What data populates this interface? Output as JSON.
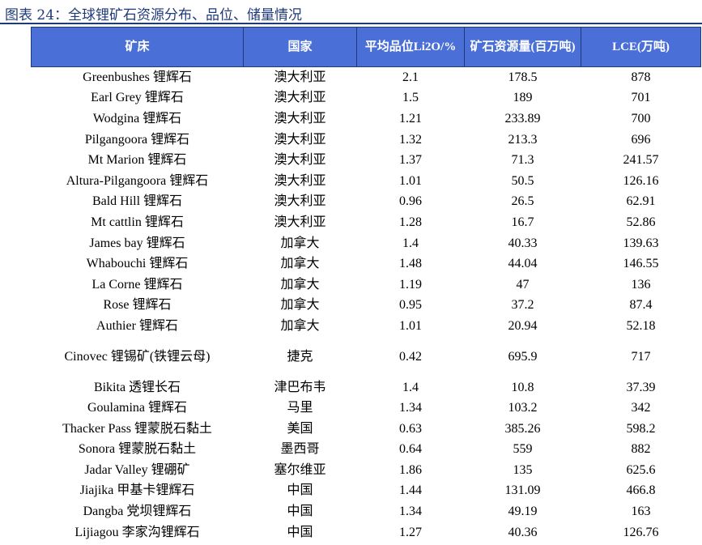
{
  "title": "图表 24：全球锂矿石资源分布、品位、储量情况",
  "headers": [
    "矿床",
    "国家",
    "平均品位Li2O/%",
    "矿石资源量(百万吨)",
    "LCE(万吨)"
  ],
  "rows": [
    {
      "name": "Greenbushes 锂辉石",
      "country": "澳大利亚",
      "grade": "2.1",
      "ore": "178.5",
      "lce": "878"
    },
    {
      "name": "Earl Grey 锂辉石",
      "country": "澳大利亚",
      "grade": "1.5",
      "ore": "189",
      "lce": "701"
    },
    {
      "name": "Wodgina 锂辉石",
      "country": "澳大利亚",
      "grade": "1.21",
      "ore": "233.89",
      "lce": "700"
    },
    {
      "name": "Pilgangoora 锂辉石",
      "country": "澳大利亚",
      "grade": "1.32",
      "ore": "213.3",
      "lce": "696"
    },
    {
      "name": "Mt Marion 锂辉石",
      "country": "澳大利亚",
      "grade": "1.37",
      "ore": "71.3",
      "lce": "241.57"
    },
    {
      "name": "Altura-Pilgangoora 锂辉石",
      "country": "澳大利亚",
      "grade": "1.01",
      "ore": "50.5",
      "lce": "126.16"
    },
    {
      "name": "Bald Hill 锂辉石",
      "country": "澳大利亚",
      "grade": "0.96",
      "ore": "26.5",
      "lce": "62.91"
    },
    {
      "name": "Mt cattlin 锂辉石",
      "country": "澳大利亚",
      "grade": "1.28",
      "ore": "16.7",
      "lce": "52.86"
    },
    {
      "name": "James bay 锂辉石",
      "country": "加拿大",
      "grade": "1.4",
      "ore": "40.33",
      "lce": "139.63"
    },
    {
      "name": "Whabouchi 锂辉石",
      "country": "加拿大",
      "grade": "1.48",
      "ore": "44.04",
      "lce": "146.55"
    },
    {
      "name": "La Corne 锂辉石",
      "country": "加拿大",
      "grade": "1.19",
      "ore": "47",
      "lce": "136"
    },
    {
      "name": "Rose 锂辉石",
      "country": "加拿大",
      "grade": "0.95",
      "ore": "37.2",
      "lce": "87.4"
    },
    {
      "name": "Authier 锂辉石",
      "country": "加拿大",
      "grade": "1.01",
      "ore": "20.94",
      "lce": "52.18"
    },
    {
      "name": "Cinovec 锂锡矿(铁锂云母)",
      "country": "捷克",
      "grade": "0.42",
      "ore": "695.9",
      "lce": "717"
    },
    {
      "name": "Bikita 透锂长石",
      "country": "津巴布韦",
      "grade": "1.4",
      "ore": "10.8",
      "lce": "37.39"
    },
    {
      "name": "Goulamina 锂辉石",
      "country": "马里",
      "grade": "1.34",
      "ore": "103.2",
      "lce": "342"
    },
    {
      "name": "Thacker Pass 锂蒙脱石黏土",
      "country": "美国",
      "grade": "0.63",
      "ore": "385.26",
      "lce": "598.2"
    },
    {
      "name": "Sonora 锂蒙脱石黏土",
      "country": "墨西哥",
      "grade": "0.64",
      "ore": "559",
      "lce": "882"
    },
    {
      "name": "Jadar Valley 锂硼矿",
      "country": "塞尔维亚",
      "grade": "1.86",
      "ore": "135",
      "lce": "625.6"
    },
    {
      "name": "Jiajika 甲基卡锂辉石",
      "country": "中国",
      "grade": "1.44",
      "ore": "131.09",
      "lce": "466.8"
    },
    {
      "name": "Dangba 党坝锂辉石",
      "country": "中国",
      "grade": "1.34",
      "ore": "49.19",
      "lce": "163"
    },
    {
      "name": "Lijiagou 李家沟锂辉石",
      "country": "中国",
      "grade": "1.27",
      "ore": "40.36",
      "lce": "126.76"
    }
  ]
}
